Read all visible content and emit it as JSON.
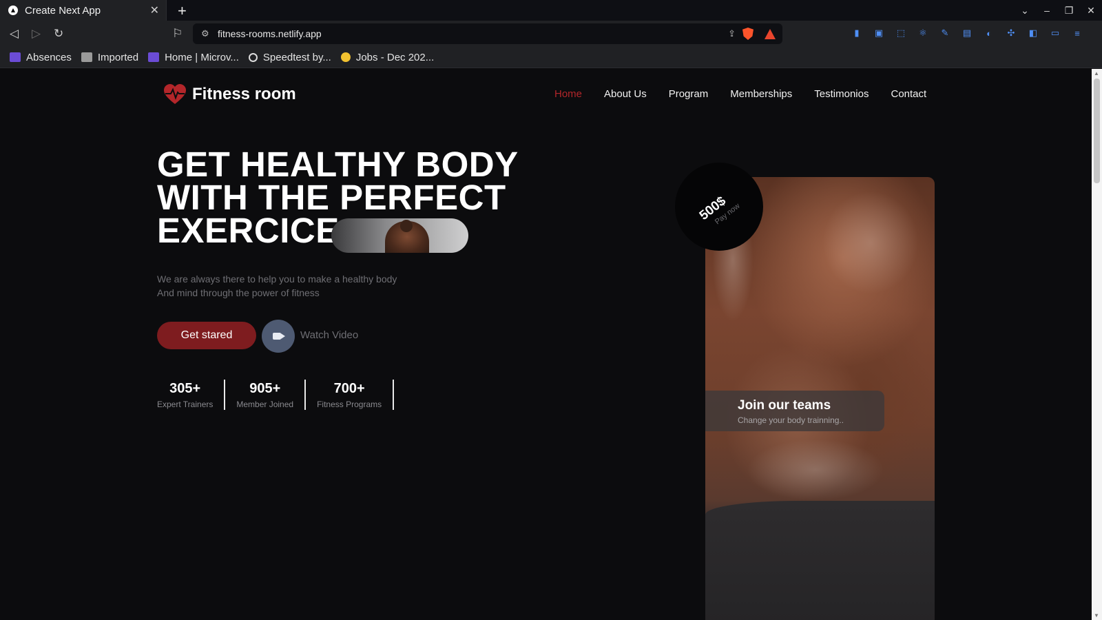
{
  "browser": {
    "tab_title": "Create Next App",
    "url": "fitness-rooms.netlify.app",
    "bookmarks": [
      {
        "label": "Absences",
        "icon": "microverse-icon"
      },
      {
        "label": "Imported",
        "icon": "folder-icon"
      },
      {
        "label": "Home | Microv...",
        "icon": "microverse-icon"
      },
      {
        "label": "Speedtest by...",
        "icon": "speedtest-icon"
      },
      {
        "label": "Jobs - Dec 202...",
        "icon": "jobs-icon"
      }
    ]
  },
  "site": {
    "brand": "Fitness room",
    "nav": [
      {
        "label": "Home",
        "active": true
      },
      {
        "label": "About Us"
      },
      {
        "label": "Program"
      },
      {
        "label": "Memberships"
      },
      {
        "label": "Testimonios"
      },
      {
        "label": "Contact"
      }
    ],
    "headline": [
      "GET HEALTHY BODY",
      "WITH THE PERFECT",
      "EXERCICE"
    ],
    "subtext": [
      "We are always there to help you to make a healthy body",
      "And mind through the power of fitness"
    ],
    "cta_label": "Get stared",
    "watch_label": "Watch Video",
    "stats": [
      {
        "value": "305+",
        "label": "Expert Trainers"
      },
      {
        "value": "905+",
        "label": "Member Joined"
      },
      {
        "value": "700+",
        "label": "Fitness Programs"
      }
    ],
    "price": {
      "amount": "500$",
      "action": "Pay now"
    },
    "join": {
      "title": "Join our teams",
      "subtitle": "Change your body trainning.."
    },
    "colors": {
      "accent": "#7e1c1f",
      "active_link": "#b3262a",
      "background": "#0c0c0e"
    }
  }
}
